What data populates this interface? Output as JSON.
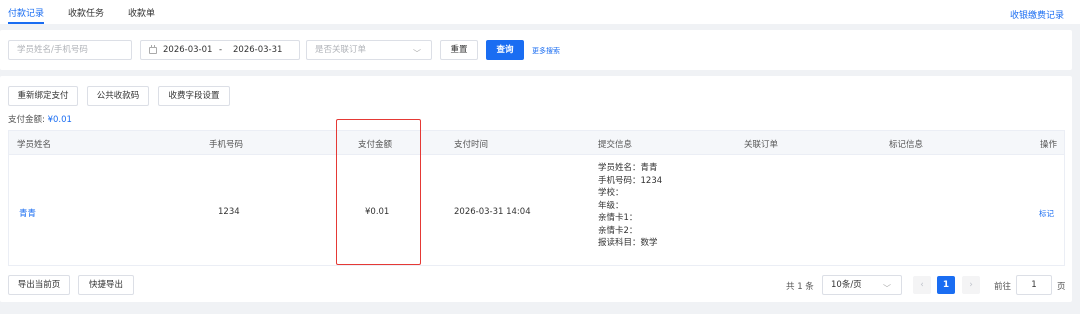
{
  "tabs": [
    {
      "label": "付款记录",
      "active": true
    },
    {
      "label": "收款任务",
      "active": false
    },
    {
      "label": "收款单",
      "active": false
    }
  ],
  "top_right_link": "收银缴费记录",
  "filters": {
    "name_phone_placeholder": "学员姓名/手机号码",
    "date_start": "2026-03-01",
    "date_sep": "-",
    "date_end": "2026-03-31",
    "order_select_placeholder": "是否关联订单",
    "reset_label": "重置",
    "search_label": "查询",
    "more_search_label": "更多搜索"
  },
  "toolbar": {
    "rebind_label": "重新绑定支付",
    "public_code_label": "公共收款码",
    "fields_setting_label": "收费字段设置"
  },
  "summary": {
    "label": "支付金额:",
    "amount": "¥0.01"
  },
  "table": {
    "columns": [
      "学员姓名",
      "手机号码",
      "支付金额",
      "支付时间",
      "提交信息",
      "关联订单",
      "标记信息",
      "操作"
    ],
    "rows": [
      {
        "name": "青青",
        "phone": "1234",
        "amount": "¥0.01",
        "time": "2026-03-31 14:04",
        "info": [
          "学员姓名：青青",
          "手机号码：1234",
          "学校：",
          "年级：",
          "亲情卡1：",
          "亲情卡2：",
          "报读科目：数学"
        ],
        "order": "",
        "mark": "",
        "action": "标记"
      }
    ]
  },
  "footer": {
    "export_current_label": "导出当前页",
    "quick_export_label": "快捷导出",
    "total_text": "共 1 条",
    "page_size": "10条/页",
    "current_page": "1",
    "goto_label": "前往",
    "goto_value": "1",
    "page_unit": "页"
  },
  "colors": {
    "accent": "#1a6df2",
    "highlight_box": "#e53935",
    "background": "#f0f2f5"
  }
}
